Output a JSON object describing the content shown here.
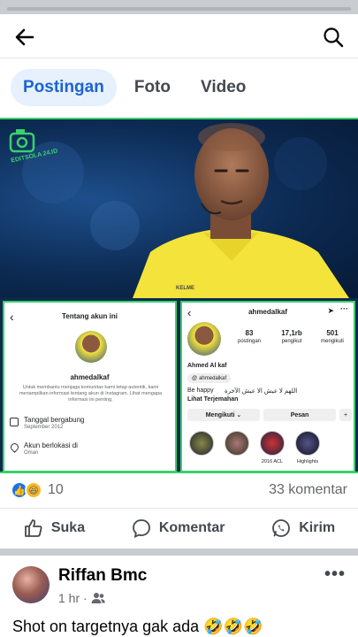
{
  "header": {
    "back_icon": "back-arrow-icon",
    "search_icon": "search-icon"
  },
  "tabs": [
    {
      "label": "Postingan",
      "active": true
    },
    {
      "label": "Foto",
      "active": false
    },
    {
      "label": "Video",
      "active": false
    }
  ],
  "photo": {
    "watermark": "EDITSOLA 24.ID",
    "jersey_brand": "KELME",
    "left_panel": {
      "title": "Tentang akun ini",
      "username": "ahmedalkaf",
      "description": "Untuk membantu menjaga komunitas kami tetap autentik, kami menampilkan informasi tentang akun di Instagram. Lihat mengapa informasi ini penting.",
      "joined_label": "Tanggal bergabung",
      "joined_value": "September 2012",
      "location_label": "Akun berlokasi di",
      "location_value": "Oman"
    },
    "right_panel": {
      "username": "ahmedalkaf",
      "posts_count": "83",
      "posts_label": "postingan",
      "followers_count": "17,1rb",
      "followers_label": "pengikut",
      "following_count": "501",
      "following_label": "mengikuti",
      "full_name": "Ahmed Al kaf",
      "threads_handle": "ahmedalkaf",
      "bio_line": "Be happy",
      "bio_arabic": "اللهم لا عيش الا عيش الآخرة",
      "translate_label": "Lihat Terjemahan",
      "follow_btn": "Mengikuti",
      "message_btn": "Pesan",
      "highlights": [
        "",
        "",
        "2016 ACL",
        "Highlights"
      ]
    }
  },
  "reactions": {
    "count": "10",
    "comments": "33 komentar"
  },
  "actions": {
    "like": "Suka",
    "comment": "Komentar",
    "share": "Kirim"
  },
  "post2": {
    "author": "Riffan Bmc",
    "time": "1 hr ·",
    "caption": "Shot on targetnya gak ada 🤣🤣🤣"
  }
}
